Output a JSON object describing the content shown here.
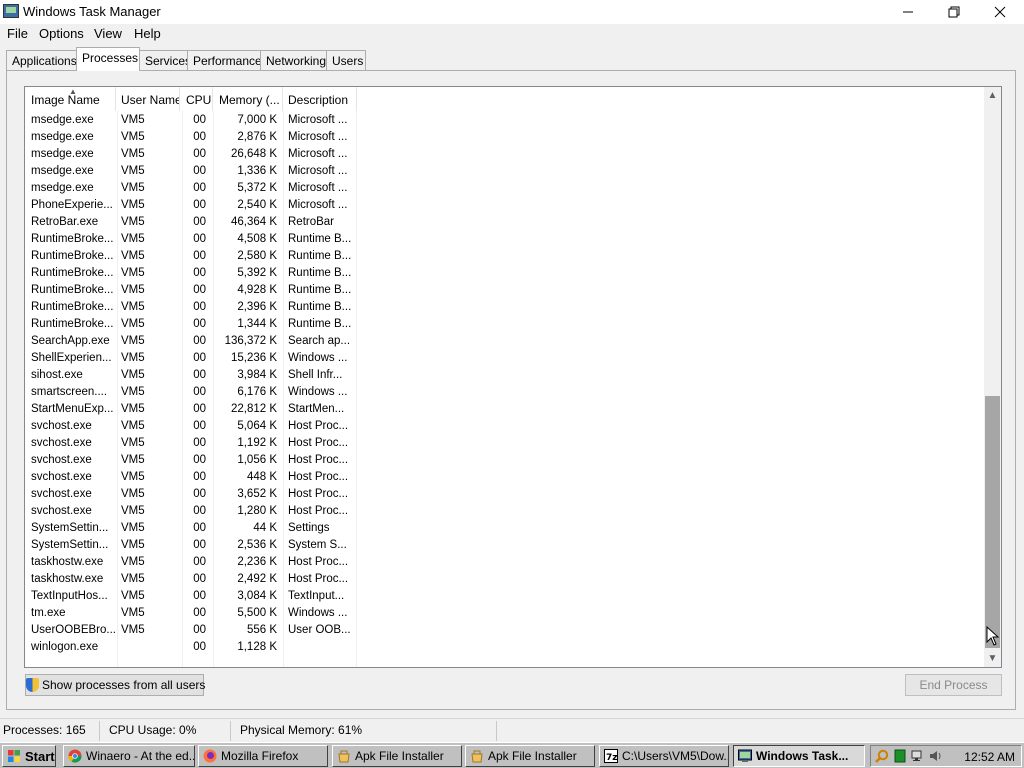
{
  "window": {
    "title": "Windows Task Manager"
  },
  "menu": [
    "File",
    "Options",
    "View",
    "Help"
  ],
  "tabs": [
    "Applications",
    "Processes",
    "Services",
    "Performance",
    "Networking",
    "Users"
  ],
  "active_tab": "Processes",
  "columns": [
    "Image Name",
    "User Name",
    "CPU",
    "Memory (...",
    "Description"
  ],
  "rows": [
    {
      "name": "msedge.exe",
      "user": "VM5",
      "cpu": "00",
      "mem": "7,000 K",
      "desc": "Microsoft ..."
    },
    {
      "name": "msedge.exe",
      "user": "VM5",
      "cpu": "00",
      "mem": "2,876 K",
      "desc": "Microsoft ..."
    },
    {
      "name": "msedge.exe",
      "user": "VM5",
      "cpu": "00",
      "mem": "26,648 K",
      "desc": "Microsoft ..."
    },
    {
      "name": "msedge.exe",
      "user": "VM5",
      "cpu": "00",
      "mem": "1,336 K",
      "desc": "Microsoft ..."
    },
    {
      "name": "msedge.exe",
      "user": "VM5",
      "cpu": "00",
      "mem": "5,372 K",
      "desc": "Microsoft ..."
    },
    {
      "name": "PhoneExperie...",
      "user": "VM5",
      "cpu": "00",
      "mem": "2,540 K",
      "desc": "Microsoft ..."
    },
    {
      "name": "RetroBar.exe",
      "user": "VM5",
      "cpu": "00",
      "mem": "46,364 K",
      "desc": "RetroBar"
    },
    {
      "name": "RuntimeBroke...",
      "user": "VM5",
      "cpu": "00",
      "mem": "4,508 K",
      "desc": "Runtime B..."
    },
    {
      "name": "RuntimeBroke...",
      "user": "VM5",
      "cpu": "00",
      "mem": "2,580 K",
      "desc": "Runtime B..."
    },
    {
      "name": "RuntimeBroke...",
      "user": "VM5",
      "cpu": "00",
      "mem": "5,392 K",
      "desc": "Runtime B..."
    },
    {
      "name": "RuntimeBroke...",
      "user": "VM5",
      "cpu": "00",
      "mem": "4,928 K",
      "desc": "Runtime B..."
    },
    {
      "name": "RuntimeBroke...",
      "user": "VM5",
      "cpu": "00",
      "mem": "2,396 K",
      "desc": "Runtime B..."
    },
    {
      "name": "RuntimeBroke...",
      "user": "VM5",
      "cpu": "00",
      "mem": "1,344 K",
      "desc": "Runtime B..."
    },
    {
      "name": "SearchApp.exe",
      "user": "VM5",
      "cpu": "00",
      "mem": "136,372 K",
      "desc": "Search ap..."
    },
    {
      "name": "ShellExperien...",
      "user": "VM5",
      "cpu": "00",
      "mem": "15,236 K",
      "desc": "Windows ..."
    },
    {
      "name": "sihost.exe",
      "user": "VM5",
      "cpu": "00",
      "mem": "3,984 K",
      "desc": "Shell Infr..."
    },
    {
      "name": "smartscreen....",
      "user": "VM5",
      "cpu": "00",
      "mem": "6,176 K",
      "desc": "Windows ..."
    },
    {
      "name": "StartMenuExp...",
      "user": "VM5",
      "cpu": "00",
      "mem": "22,812 K",
      "desc": "StartMen..."
    },
    {
      "name": "svchost.exe",
      "user": "VM5",
      "cpu": "00",
      "mem": "5,064 K",
      "desc": "Host Proc..."
    },
    {
      "name": "svchost.exe",
      "user": "VM5",
      "cpu": "00",
      "mem": "1,192 K",
      "desc": "Host Proc..."
    },
    {
      "name": "svchost.exe",
      "user": "VM5",
      "cpu": "00",
      "mem": "1,056 K",
      "desc": "Host Proc..."
    },
    {
      "name": "svchost.exe",
      "user": "VM5",
      "cpu": "00",
      "mem": "448 K",
      "desc": "Host Proc..."
    },
    {
      "name": "svchost.exe",
      "user": "VM5",
      "cpu": "00",
      "mem": "3,652 K",
      "desc": "Host Proc..."
    },
    {
      "name": "svchost.exe",
      "user": "VM5",
      "cpu": "00",
      "mem": "1,280 K",
      "desc": "Host Proc..."
    },
    {
      "name": "SystemSettin...",
      "user": "VM5",
      "cpu": "00",
      "mem": "44 K",
      "desc": "Settings"
    },
    {
      "name": "SystemSettin...",
      "user": "VM5",
      "cpu": "00",
      "mem": "2,536 K",
      "desc": "System S..."
    },
    {
      "name": "taskhostw.exe",
      "user": "VM5",
      "cpu": "00",
      "mem": "2,236 K",
      "desc": "Host Proc..."
    },
    {
      "name": "taskhostw.exe",
      "user": "VM5",
      "cpu": "00",
      "mem": "2,492 K",
      "desc": "Host Proc..."
    },
    {
      "name": "TextInputHos...",
      "user": "VM5",
      "cpu": "00",
      "mem": "3,084 K",
      "desc": "TextInput..."
    },
    {
      "name": "tm.exe",
      "user": "VM5",
      "cpu": "00",
      "mem": "5,500 K",
      "desc": "Windows ..."
    },
    {
      "name": "UserOOBEBro...",
      "user": "VM5",
      "cpu": "00",
      "mem": "556 K",
      "desc": "User OOB..."
    },
    {
      "name": "winlogon.exe",
      "user": "",
      "cpu": "00",
      "mem": "1,128 K",
      "desc": ""
    }
  ],
  "buttons": {
    "show_all": "Show processes from all users",
    "end_process": "End Process"
  },
  "status": {
    "processes": "Processes: 165",
    "cpu": "CPU Usage: 0%",
    "memory": "Physical Memory: 61%"
  },
  "taskbar": {
    "start": "Start",
    "items": [
      {
        "label": "Winaero - At the ed...",
        "icon": "chrome-icon"
      },
      {
        "label": "Mozilla Firefox",
        "icon": "firefox-icon"
      },
      {
        "label": "Apk File Installer",
        "icon": "apk-icon"
      },
      {
        "label": "Apk File Installer",
        "icon": "apk-icon"
      },
      {
        "label": "C:\\Users\\VM5\\Dow...",
        "icon": "7zip-icon"
      },
      {
        "label": "Windows Task...",
        "icon": "taskmgr-icon"
      }
    ],
    "clock": "12:52 AM"
  },
  "colors": {
    "scroll_thumb": "#a6a6a6",
    "taskbar": "#c0c0c0",
    "window_bg": "#f0f0f0"
  }
}
